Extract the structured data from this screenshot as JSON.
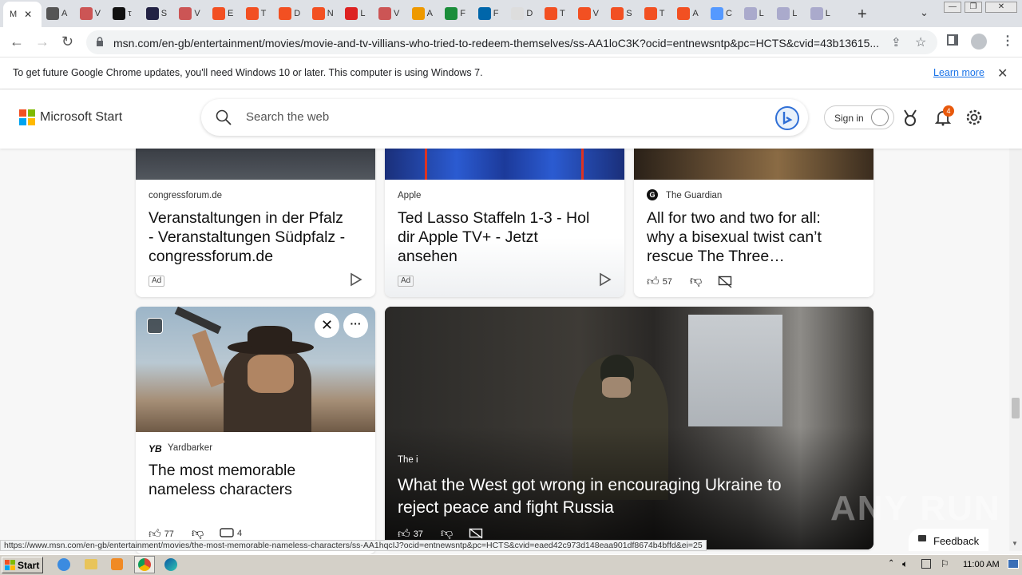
{
  "browser": {
    "active_tab_label": "M",
    "tabs": [
      "A",
      "V",
      "τ",
      "S",
      "V",
      "E",
      "T",
      "D",
      "N",
      "L",
      "V",
      "A",
      "F",
      "F",
      "D",
      "T",
      "V",
      "S",
      "T",
      "A",
      "C",
      "L",
      "L",
      "L"
    ],
    "address_url": "msn.com/en-gb/entertainment/movies/movie-and-tv-villians-who-tried-to-redeem-themselves/ss-AA1loC3K?ocid=entnewsntp&pc=HCTS&cvid=43b13615...",
    "new_tab_glyph": "+",
    "tab_menu_glyph": "⌄",
    "window_min": "—",
    "window_restore": "❐",
    "window_close": "✕"
  },
  "infobar": {
    "message": "To get future Google Chrome updates, you'll need Windows 10 or later. This computer is using Windows 7.",
    "learn_more": "Learn more",
    "close_glyph": "✕"
  },
  "msn": {
    "brand": "Microsoft Start",
    "search_placeholder": "Search the web",
    "sign_in": "Sign in",
    "notification_count": "4",
    "colors": {
      "ms_red": "#f25022",
      "ms_green": "#7fba00",
      "ms_blue": "#00a4ef",
      "ms_yellow": "#ffb900",
      "notif": "#e8590c"
    }
  },
  "cards_row1": [
    {
      "source": "congressforum.de",
      "headline_lines": [
        "Veranstaltungen in der Pfalz",
        "- Veranstaltungen Südpfalz -",
        "congressforum.de"
      ],
      "badge": "Ad"
    },
    {
      "source": "Apple",
      "headline_lines": [
        "Ted Lasso Staffeln 1-3 - Hol",
        "dir Apple TV+ - Jetzt",
        "ansehen"
      ],
      "badge": "Ad"
    },
    {
      "source": "The Guardian",
      "headline_lines": [
        "All for two and two for all:",
        "why a bisexual twist can’t",
        "rescue The Three…"
      ],
      "likes": "57"
    }
  ],
  "card_nameless": {
    "source": "Yardbarker",
    "headline_lines": [
      "The most memorable",
      "nameless characters"
    ],
    "likes": "77",
    "comments": "4"
  },
  "card_ukraine": {
    "source": "The i",
    "headline_lines": [
      "What the West got wrong in encouraging Ukraine to",
      "reject peace and fight Russia"
    ],
    "likes": "37"
  },
  "status_url": "https://www.msn.com/en-gb/entertainment/movies/the-most-memorable-nameless-characters/ss-AA1hqcIJ?ocid=entnewsntp&pc=HCTS&cvid=eaed42c973d148eaa901df8674b4bffd&ei=25",
  "feedback_label": "Feedback",
  "watermark": "ANY RUN",
  "taskbar": {
    "start_label": "Start",
    "clock": "11:00 AM"
  }
}
